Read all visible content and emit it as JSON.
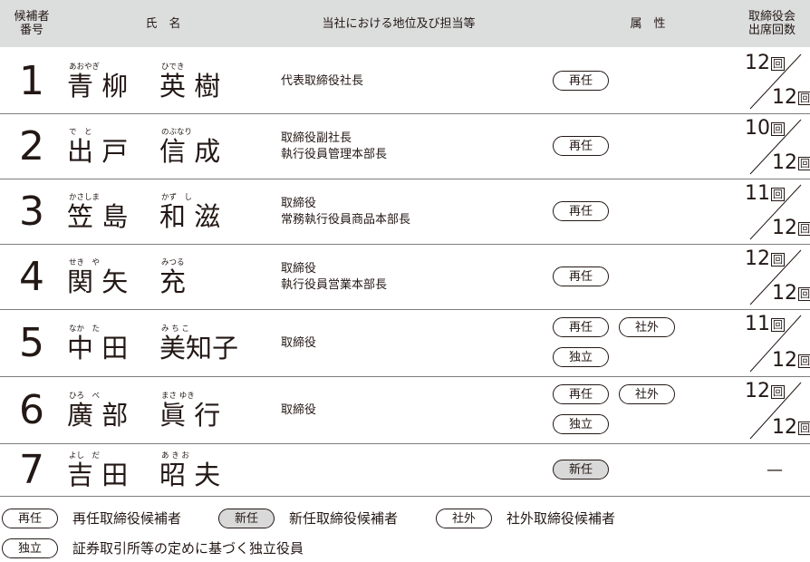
{
  "header": {
    "number": "候補者\n番号",
    "name": "氏　名",
    "position": "当社における地位及び担当等",
    "attribute": "属　性",
    "attendance": "取締役会\n出席回数"
  },
  "badges": {
    "reelect": "再任",
    "new": "新任",
    "outside": "社外",
    "independent": "独立"
  },
  "kai_unit": "回",
  "candidates": [
    {
      "num": "1",
      "ruby": [
        "あおやぎ",
        "ひでき"
      ],
      "surname": "青 柳",
      "given": "英 樹",
      "positions": [
        "代表取締役社長"
      ],
      "badges": [
        "再任"
      ],
      "attended": "12",
      "total": "12"
    },
    {
      "num": "2",
      "ruby": [
        "で　と",
        "のぶなり"
      ],
      "surname": "出 戸",
      "given": "信 成",
      "positions": [
        "取締役副社長",
        "執行役員管理本部長"
      ],
      "badges": [
        "再任"
      ],
      "attended": "10",
      "total": "12"
    },
    {
      "num": "3",
      "ruby": [
        "かさしま",
        "かず　し"
      ],
      "surname": "笠 島",
      "given": "和 滋",
      "positions": [
        "取締役",
        "常務執行役員商品本部長"
      ],
      "badges": [
        "再任"
      ],
      "attended": "11",
      "total": "12"
    },
    {
      "num": "4",
      "ruby": [
        "せき　や",
        "みつる"
      ],
      "surname": "関 矢",
      "given": "充",
      "positions": [
        "取締役",
        "執行役員営業本部長"
      ],
      "badges": [
        "再任"
      ],
      "attended": "12",
      "total": "12"
    },
    {
      "num": "5",
      "ruby": [
        "なか　た",
        "み ち こ"
      ],
      "surname": "中 田",
      "given": "美知子",
      "positions": [
        "取締役"
      ],
      "badges": [
        "再任",
        "社外",
        "独立"
      ],
      "attended": "11",
      "total": "12"
    },
    {
      "num": "6",
      "ruby": [
        "ひろ　べ",
        "まさ ゆき"
      ],
      "surname": "廣 部",
      "given": "眞 行",
      "positions": [
        "取締役"
      ],
      "badges": [
        "再任",
        "社外",
        "独立"
      ],
      "attended": "12",
      "total": "12"
    },
    {
      "num": "7",
      "ruby": [
        "よし　だ",
        "あ き お"
      ],
      "surname": "吉 田",
      "given": "昭 夫",
      "positions": [],
      "badges": [
        "新任"
      ],
      "attended": "—",
      "total": ""
    }
  ],
  "legend": {
    "reelect_text": "再任取締役候補者",
    "new_text": "新任取締役候補者",
    "outside_text": "社外取締役候補者",
    "independent_text": "証券取引所等の定めに基づく独立役員"
  }
}
